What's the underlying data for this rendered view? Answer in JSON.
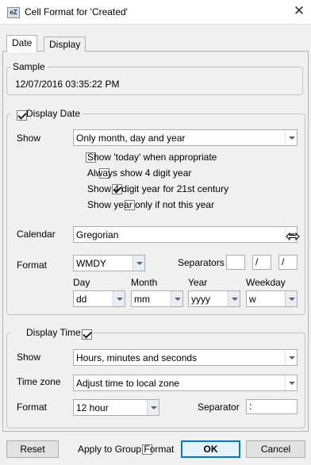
{
  "window": {
    "title": "Cell Format for 'Created'",
    "icon_text": "eZ"
  },
  "tabs": [
    {
      "label": "Date"
    },
    {
      "label": "Display"
    }
  ],
  "sample": {
    "legend": "Sample",
    "value": "12/07/2016 03:35:22 PM"
  },
  "display_date": {
    "legend": "Display Date",
    "checked": true,
    "show_label": "Show",
    "show_value": "Only month, day and year",
    "options": [
      {
        "label": "Show 'today' when appropriate",
        "checked": false
      },
      {
        "label": "Always show 4 digit year",
        "checked": false
      },
      {
        "label": "Show 4 digit year for 21st century",
        "checked": true
      },
      {
        "label": "Show year only if not this year",
        "checked": false
      }
    ],
    "calendar_label": "Calendar",
    "calendar_value": "Gregorian",
    "format_label": "Format",
    "format_value": "WMDY",
    "separators_label": "Separators",
    "separators": [
      "",
      "/",
      "/"
    ],
    "day_label": "Day",
    "day_value": "dd",
    "month_label": "Month",
    "month_value": "mm",
    "year_label": "Year",
    "year_value": "yyyy",
    "weekday_label": "Weekday",
    "weekday_value": "w"
  },
  "display_time": {
    "legend": "Display Time",
    "checked": true,
    "show_label": "Show",
    "show_value": "Hours, minutes and seconds",
    "timezone_label": "Time zone",
    "timezone_value": "Adjust time to local zone",
    "format_label": "Format",
    "format_value": "12 hour",
    "separator_label": "Separator",
    "separator_value": ":"
  },
  "footer": {
    "reset_label": "Reset",
    "apply_group_label": "Apply to Group Format",
    "apply_group_checked": false,
    "ok_label": "OK",
    "cancel_label": "Cancel"
  }
}
